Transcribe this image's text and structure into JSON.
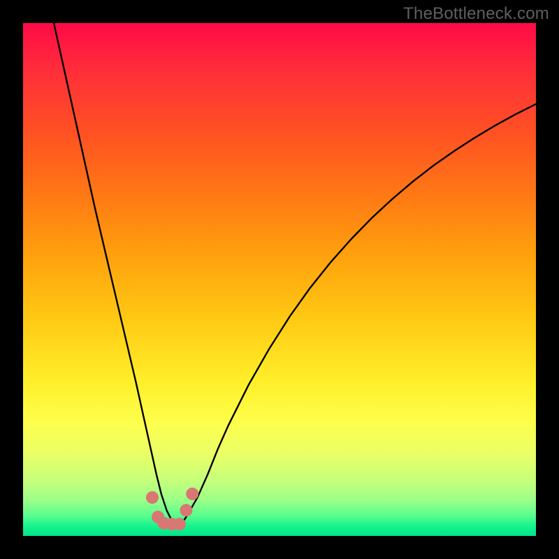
{
  "watermark": "TheBottleneck.com",
  "chart_data": {
    "type": "line",
    "title": "",
    "xlabel": "",
    "ylabel": "",
    "xlim": [
      0,
      100
    ],
    "ylim": [
      0,
      100
    ],
    "curve": {
      "x": [
        6,
        8,
        10,
        12,
        14,
        16,
        18,
        20,
        22,
        24,
        25,
        26,
        27,
        28,
        29,
        30,
        31,
        32,
        34,
        36,
        38,
        40,
        44,
        48,
        52,
        56,
        60,
        64,
        68,
        72,
        76,
        80,
        84,
        88,
        92,
        96,
        100
      ],
      "y": [
        100,
        91,
        82,
        73,
        64,
        55.5,
        47,
        38.5,
        30,
        21,
        16.5,
        12,
        8,
        5,
        3,
        2,
        2.5,
        4,
        7.5,
        12,
        17,
        21.5,
        29.5,
        36.5,
        42.8,
        48.4,
        53.4,
        57.9,
        62,
        65.7,
        69.1,
        72.2,
        75,
        77.6,
        80,
        82.2,
        84.2
      ]
    },
    "marker_points": {
      "x": [
        25.2,
        26.3,
        27.4,
        29.0,
        30.5,
        31.8,
        33.0
      ],
      "y": [
        7.5,
        3.7,
        2.5,
        2.3,
        2.3,
        5.0,
        8.2
      ]
    },
    "colors": {
      "curve": "#000000",
      "markers": "#d97772",
      "gradient_top": "#ff0a46",
      "gradient_bottom": "#00e58a"
    }
  }
}
